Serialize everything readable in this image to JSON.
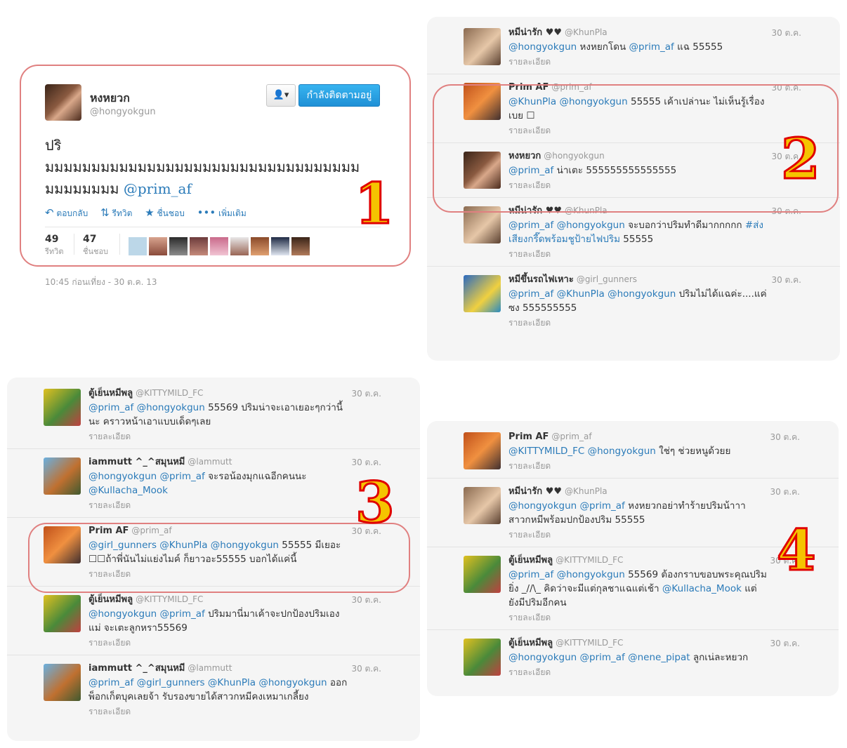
{
  "p1": {
    "name": "หงหยวก",
    "handle": "@hongyokgun",
    "follow_label": "กำลังติดตามอยู่",
    "text_line1": "ปริ",
    "text_line2": "มมมมมมมมมมมมมมมมมมมมมมมมมมมมมมมมมม",
    "text_line3": "มมมมมมมม",
    "mention": "@prim_af",
    "actions": {
      "reply": "ตอบกลับ",
      "retweet": "รีทวิต",
      "fav": "ชื่นชอบ",
      "more": "เพิ่มเติม"
    },
    "rt_count": "49",
    "rt_label": "รีทวิต",
    "fav_count": "47",
    "fav_label": "ชื่นชอบ",
    "timestamp": "10:45 ก่อนเที่ยง - 30 ต.ค. 13",
    "badge": "1"
  },
  "p2": {
    "badge": "2",
    "tweets": [
      {
        "name": "หมีน่ารัก ♥♥",
        "handle": "@KhunPla",
        "time": "30 ต.ค.",
        "parts": [
          {
            "m": "@hongyokgun"
          },
          {
            "t": " หงหยกโดน "
          },
          {
            "m": "@prim_af"
          },
          {
            "t": " แฉ 55555"
          }
        ],
        "detail": "รายละเอียด"
      },
      {
        "name": "Prim AF",
        "handle": "@prim_af",
        "time": "30 ต.ค.",
        "parts": [
          {
            "m": "@KhunPla"
          },
          {
            "t": " "
          },
          {
            "m": "@hongyokgun"
          },
          {
            "t": " 55555 เค้าเปล่านะ ไม่เห็นรู้เรื่อง เบย ☐"
          }
        ],
        "detail": "รายละเอียด"
      },
      {
        "name": "หงหยวก",
        "handle": "@hongyokgun",
        "time": "30 ต.ค.",
        "parts": [
          {
            "m": "@prim_af"
          },
          {
            "t": " น่าเตะ 555555555555555"
          }
        ],
        "detail": "รายละเอียด"
      },
      {
        "name": "หมีน่ารัก ♥♥",
        "handle": "@KhunPla",
        "time": "30 ต.ค.",
        "parts": [
          {
            "m": "@prim_af"
          },
          {
            "t": " "
          },
          {
            "m": "@hongyokgun"
          },
          {
            "t": " จะบอกว่าปริมทำดีมากกกกก "
          },
          {
            "m": "#ส่งเสียงกรี๊ดพร้อมชูป้ายไฟปริม"
          },
          {
            "t": " 55555"
          }
        ],
        "detail": "รายละเอียด"
      },
      {
        "name": "หมีขึ้นรถไฟเหาะ",
        "handle": "@girl_gunners",
        "time": "30 ต.ค.",
        "parts": [
          {
            "m": "@prim_af"
          },
          {
            "t": " "
          },
          {
            "m": "@KhunPla"
          },
          {
            "t": " "
          },
          {
            "m": "@hongyokgun"
          },
          {
            "t": " ปริมไม่ได้แฉค่ะ....แค่ซง 555555555"
          }
        ],
        "detail": "รายละเอียด"
      }
    ]
  },
  "p3": {
    "badge": "3",
    "tweets": [
      {
        "name": "ตู้เย็นหมีพลู",
        "handle": "@KITTYMILD_FC",
        "time": "30 ต.ค.",
        "parts": [
          {
            "m": "@prim_af"
          },
          {
            "t": " "
          },
          {
            "m": "@hongyokgun"
          },
          {
            "t": " 55569 ปริมน่าจะเอาเยอะๆกว่านี้นะ คราวหน้าเอาแบบเด็ดๆเลย"
          }
        ],
        "detail": "รายละเอียด"
      },
      {
        "name": "iammutt ^_^สมุนหมี",
        "handle": "@lammutt",
        "time": "30 ต.ค.",
        "parts": [
          {
            "m": "@hongyokgun"
          },
          {
            "t": " "
          },
          {
            "m": "@prim_af"
          },
          {
            "t": " จะรอน้องมุกแฉอีกคนนะ "
          },
          {
            "m": "@Kullacha_Mook"
          }
        ],
        "detail": "รายละเอียด"
      },
      {
        "name": "Prim AF",
        "handle": "@prim_af",
        "time": "30 ต.ค.",
        "parts": [
          {
            "m": "@girl_gunners"
          },
          {
            "t": " "
          },
          {
            "m": "@KhunPla"
          },
          {
            "t": " "
          },
          {
            "m": "@hongyokgun"
          },
          {
            "t": " 55555 มีเยอะ ☐☐ถ้าพี่นันไม่แย่งไมค์ ก็ยาวอะ55555 บอกได้แค่นี้"
          }
        ],
        "detail": "รายละเอียด"
      },
      {
        "name": "ตู้เย็นหมีพลู",
        "handle": "@KITTYMILD_FC",
        "time": "30 ต.ค.",
        "parts": [
          {
            "m": "@hongyokgun"
          },
          {
            "t": " "
          },
          {
            "m": "@prim_af"
          },
          {
            "t": " ปริมมานี่มาเค้าจะปกป้องปริมเองแม่ จะเตะลูกหรา55569"
          }
        ],
        "detail": "รายละเอียด"
      },
      {
        "name": "iammutt ^_^สมุนหมี",
        "handle": "@lammutt",
        "time": "30 ต.ค.",
        "parts": [
          {
            "m": "@prim_af"
          },
          {
            "t": " "
          },
          {
            "m": "@girl_gunners"
          },
          {
            "t": " "
          },
          {
            "m": "@KhunPla"
          },
          {
            "t": " "
          },
          {
            "m": "@hongyokgun"
          },
          {
            "t": " ออกพ็อกเก็ตบุคเลยจ้า รับรองขายได้สาวกหมีคงเหมาเกลี้ยง"
          }
        ],
        "detail": "รายละเอียด"
      }
    ]
  },
  "p4": {
    "badge": "4",
    "tweets": [
      {
        "name": "Prim AF",
        "handle": "@prim_af",
        "time": "30 ต.ค.",
        "parts": [
          {
            "m": "@KITTYMILD_FC"
          },
          {
            "t": " "
          },
          {
            "m": "@hongyokgun"
          },
          {
            "t": " ใช่ๆ ช่วยหนูด้วยย"
          }
        ],
        "detail": "รายละเอียด"
      },
      {
        "name": "หมีน่ารัก ♥♥",
        "handle": "@KhunPla",
        "time": "30 ต.ค.",
        "parts": [
          {
            "m": "@hongyokgun"
          },
          {
            "t": " "
          },
          {
            "m": "@prim_af"
          },
          {
            "t": " หงหยวกอย่าทำร้ายปริมน้าาา สาวกหมีพร้อมปกป้องปริม 55555"
          }
        ],
        "detail": "รายละเอียด"
      },
      {
        "name": "ตู้เย็นหมีพลู",
        "handle": "@KITTYMILD_FC",
        "time": "30 ต.ค.",
        "parts": [
          {
            "m": "@prim_af"
          },
          {
            "t": " "
          },
          {
            "m": "@hongyokgun"
          },
          {
            "t": " 55569 ต้องกราบขอบพระคุณปริมยิ่ง _//\\_ คิดว่าจะมีแต่กุลชาแฉแต่เช้า "
          },
          {
            "m": "@Kullacha_Mook"
          },
          {
            "t": " แต่ยังมีปริมอีกคน"
          }
        ],
        "detail": "รายละเอียด"
      },
      {
        "name": "ตู้เย็นหมีพลู",
        "handle": "@KITTYMILD_FC",
        "time": "30 ต.ค.",
        "parts": [
          {
            "m": "@hongyokgun"
          },
          {
            "t": " "
          },
          {
            "m": "@prim_af"
          },
          {
            "t": " "
          },
          {
            "m": "@nene_pipat"
          },
          {
            "t": " ลูกเน่ละหยวก"
          }
        ],
        "detail": "รายละเอียด"
      }
    ]
  },
  "colors": {
    "link": "#2b7bb9",
    "badge_fill": "#f5c400",
    "badge_stroke": "#e00000",
    "highlight": "#e08080",
    "follow": "#1f90d6"
  }
}
